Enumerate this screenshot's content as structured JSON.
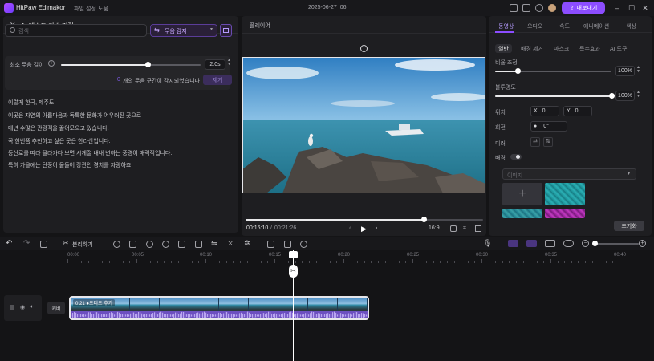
{
  "titlebar": {
    "app_title": "HitPaw Edimakor",
    "menus": [
      "파일",
      "설정",
      "도움"
    ],
    "doc_title": "2025-06-27_06",
    "export_label": "내보내기"
  },
  "left": {
    "header": "AI 텍스트 기반 편집",
    "search_placeholder": "검색",
    "mode": "무음 감지",
    "silence_label": "최소 무음 길이",
    "silence_value": "2.0s",
    "detect_count": "0",
    "detect_text": "개의 무음 구간이 감지되었습니다",
    "remove_label": "제거",
    "lines": [
      "이렇게 한국, 제주도",
      "이곳은 자연의 아름다움과 독특한 문화가 어우러진 곳으로",
      "매년 수많은 관광객을 끌어모으고 있습니다.",
      "꼭 한번쯤 추천하고 싶은 곳은 한라산입니다.",
      "등산로를 따라 올라가다 보면 시계절 내내 변하는 풍경이 매력적입니다.",
      "특히 가을에는 단풍이 물들어 장관인 경치를 자랑하죠."
    ]
  },
  "preview": {
    "header": "플레이어",
    "time_current": "00:16:10",
    "time_total": "00:21:26",
    "time_sep": "/",
    "ratio": "16:9",
    "progress": 0.75
  },
  "right": {
    "tabs": [
      "동영상",
      "오디오",
      "속도",
      "애니메이션",
      "색상"
    ],
    "subtabs": [
      "일반",
      "배경 제거",
      "마스크",
      "특수효과",
      "AI 도구"
    ],
    "scale_label": "비율 조정",
    "scale_value": "100%",
    "opacity_label": "불투명도",
    "opacity_value": "100%",
    "position_label": "위치",
    "pos_x_label": "X",
    "pos_x": "0",
    "pos_y_label": "Y",
    "pos_y": "0",
    "rotate_label": "회전",
    "rotate_value": "0°",
    "mirror_label": "미러",
    "bg_label": "배경",
    "bg_select": "이미지",
    "reset_label": "초기화",
    "scale_fraction": 0.19,
    "opacity_fraction": 1.0
  },
  "toolbar": {
    "split_label": "분리하기"
  },
  "timeline": {
    "ticks": [
      "00:00",
      "00:05",
      "00:10",
      "00:15",
      "00:20",
      "00:25",
      "00:30",
      "00:35",
      "00:40"
    ],
    "track_label": "커버",
    "clip_label": "0:21 ●오디오 추가"
  },
  "colors": {
    "accent": "#8c4dff"
  }
}
